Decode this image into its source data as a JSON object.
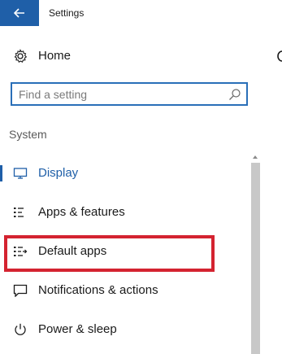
{
  "window": {
    "title": "Settings",
    "accent_color": "#1f5fa8"
  },
  "back_button": {
    "icon": "arrow-left-icon"
  },
  "home": {
    "label": "Home",
    "icon": "gear-icon"
  },
  "search": {
    "placeholder": "Find a setting",
    "value": "",
    "icon": "search-icon"
  },
  "section": {
    "label": "System"
  },
  "nav": {
    "items": [
      {
        "label": "Display",
        "icon": "monitor-icon",
        "active": true
      },
      {
        "label": "Apps & features",
        "icon": "list-icon",
        "active": false
      },
      {
        "label": "Default apps",
        "icon": "default-apps-icon",
        "active": false,
        "highlighted": true
      },
      {
        "label": "Notifications & actions",
        "icon": "notification-icon",
        "active": false
      },
      {
        "label": "Power & sleep",
        "icon": "power-icon",
        "active": false
      }
    ]
  },
  "highlight_color": "#d42330"
}
